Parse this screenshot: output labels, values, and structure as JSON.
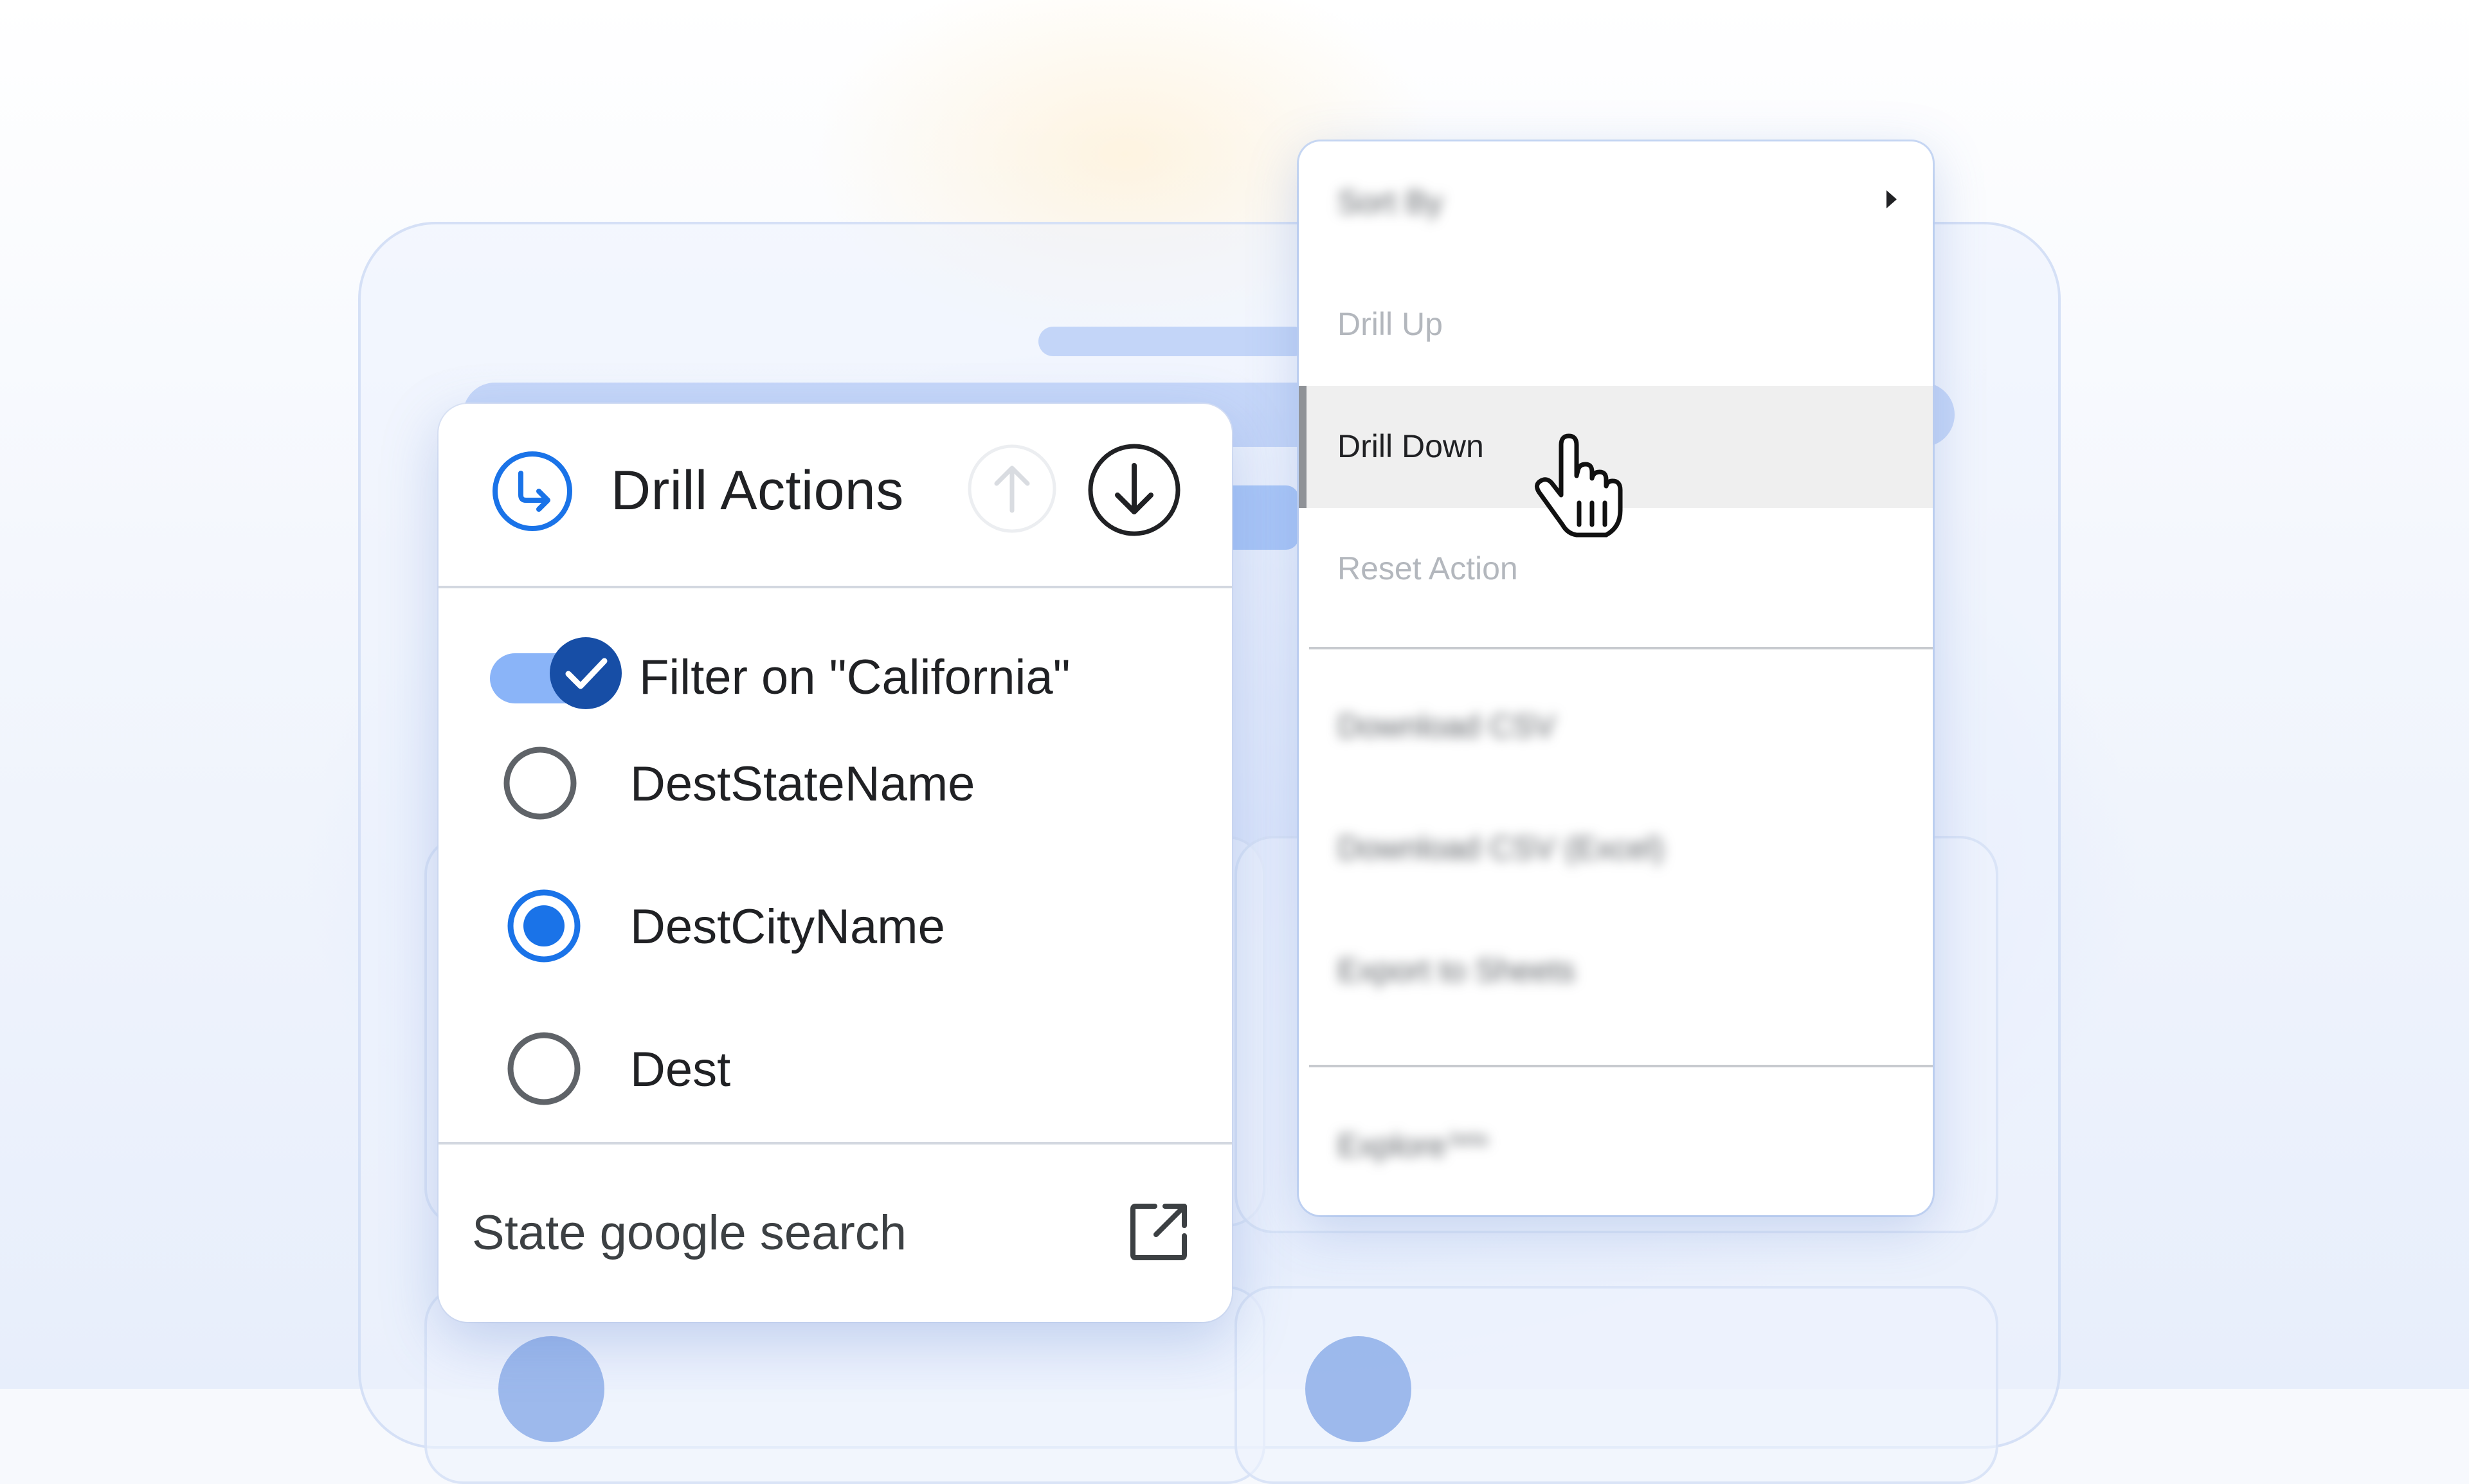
{
  "drill_panel": {
    "title": "Drill Actions",
    "filter_label": "Filter on \"California\"",
    "filter_enabled": true,
    "options": [
      {
        "label": "DestStateName",
        "selected": false
      },
      {
        "label": "DestCityName",
        "selected": true
      },
      {
        "label": "Dest",
        "selected": false
      }
    ],
    "footer_link": "State google search",
    "icons": {
      "header": "drill-arrow-icon",
      "up": "arrow-up-icon",
      "down": "arrow-down-icon",
      "external": "open-in-new-icon"
    }
  },
  "context_menu": {
    "items": [
      {
        "label": "Sort By",
        "state": "blurred",
        "has_submenu": true
      },
      {
        "label": "Drill Up",
        "state": "disabled"
      },
      {
        "label": "Drill Down",
        "state": "hovered"
      },
      {
        "label": "Reset Action",
        "state": "disabled"
      },
      {
        "label": "Download CSV",
        "state": "blurred"
      },
      {
        "label": "Download CSV (Excel)",
        "state": "blurred"
      },
      {
        "label": "Export to Sheets",
        "state": "blurred"
      },
      {
        "label": "Explore",
        "state": "blurred",
        "superscript": "beta"
      }
    ]
  },
  "colors": {
    "accent_blue": "#1a73e8",
    "dark_blue": "#174ea6",
    "toggle_track": "#8ab4f8",
    "text_primary": "#202124",
    "text_disabled": "#b3b7bd",
    "hover_bg": "#efefef"
  }
}
